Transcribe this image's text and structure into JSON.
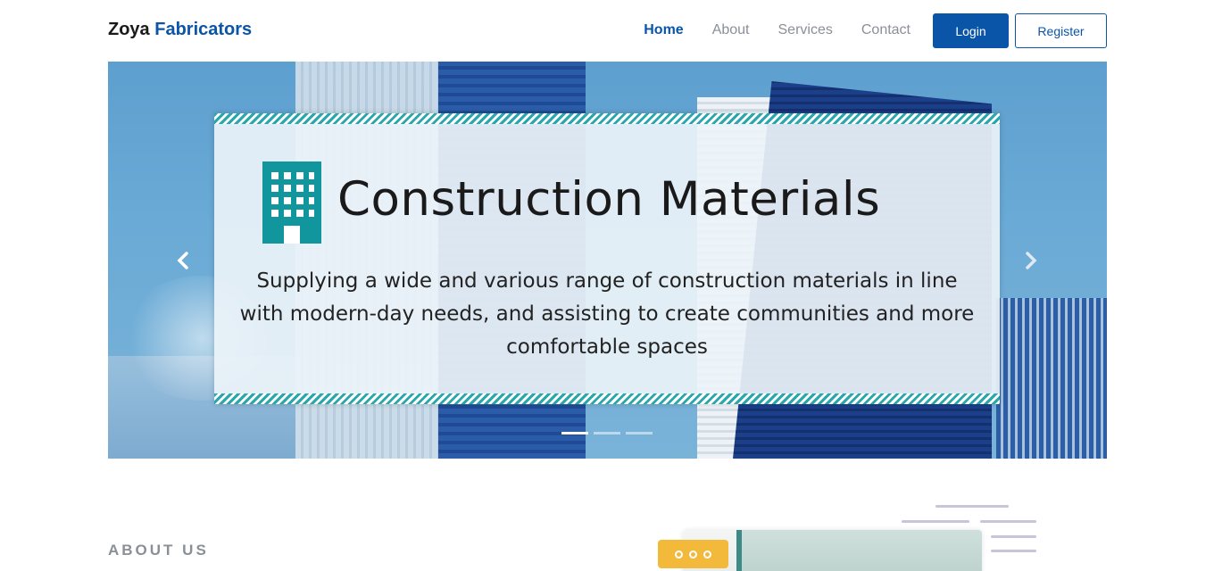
{
  "nav": {
    "brand_first": "Zoya",
    "brand_second": "Fabricators",
    "links": [
      "Home",
      "About",
      "Services",
      "Contact"
    ],
    "active": "Home",
    "login_label": "Login",
    "register_label": "Register"
  },
  "carousel": {
    "banner_title": "Construction Materials",
    "banner_subtitle": "Supplying a wide and various range of construction materials in line with modern-day needs, and assisting to create communities and more comfortable spaces",
    "prev_icon": "chevron-left-icon",
    "next_icon": "chevron-right-icon",
    "slide_count": 3,
    "active_slide": 1
  },
  "about": {
    "label": "ABOUT US"
  },
  "colors": {
    "brand": "#0b55a8",
    "muted_text": "#8a8f98",
    "accent_teal": "#2aa7ad",
    "chip": "#f2b93b"
  }
}
